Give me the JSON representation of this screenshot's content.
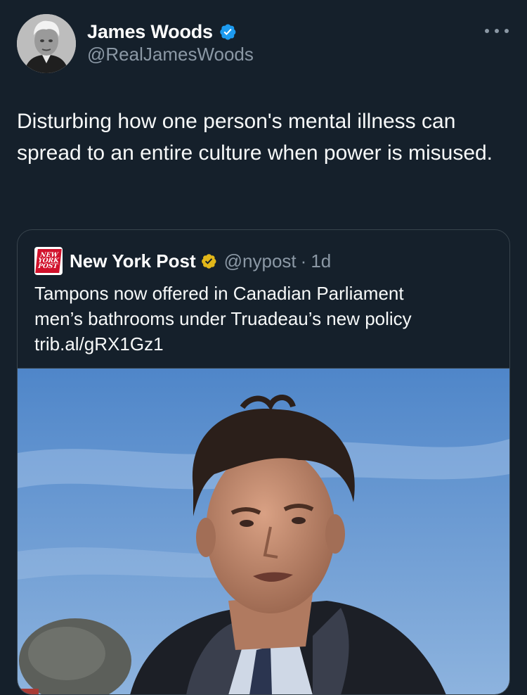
{
  "author": {
    "display_name": "James Woods",
    "handle": "@RealJamesWoods",
    "verified_color": "#1d9bf0"
  },
  "tweet": {
    "text": "Disturbing how one person's mental illness can spread to an entire culture when power is misused."
  },
  "quote": {
    "logo_text": [
      "NEW",
      "YORK",
      "POST"
    ],
    "display_name": "New York Post",
    "handle": "@nypost",
    "separator": "·",
    "time": "1d",
    "verified_color": "#e2b719",
    "text_line1": "Tampons now offered in Canadian Parliament",
    "text_line2": "men’s bathrooms under Truadeau’s new policy",
    "link": "trib.al/gRX1Gz1",
    "image_icon": "photo-of-man-speaking-at-microphone"
  },
  "icons": {
    "more": "more-options-icon",
    "verified": "verified-badge-icon"
  }
}
